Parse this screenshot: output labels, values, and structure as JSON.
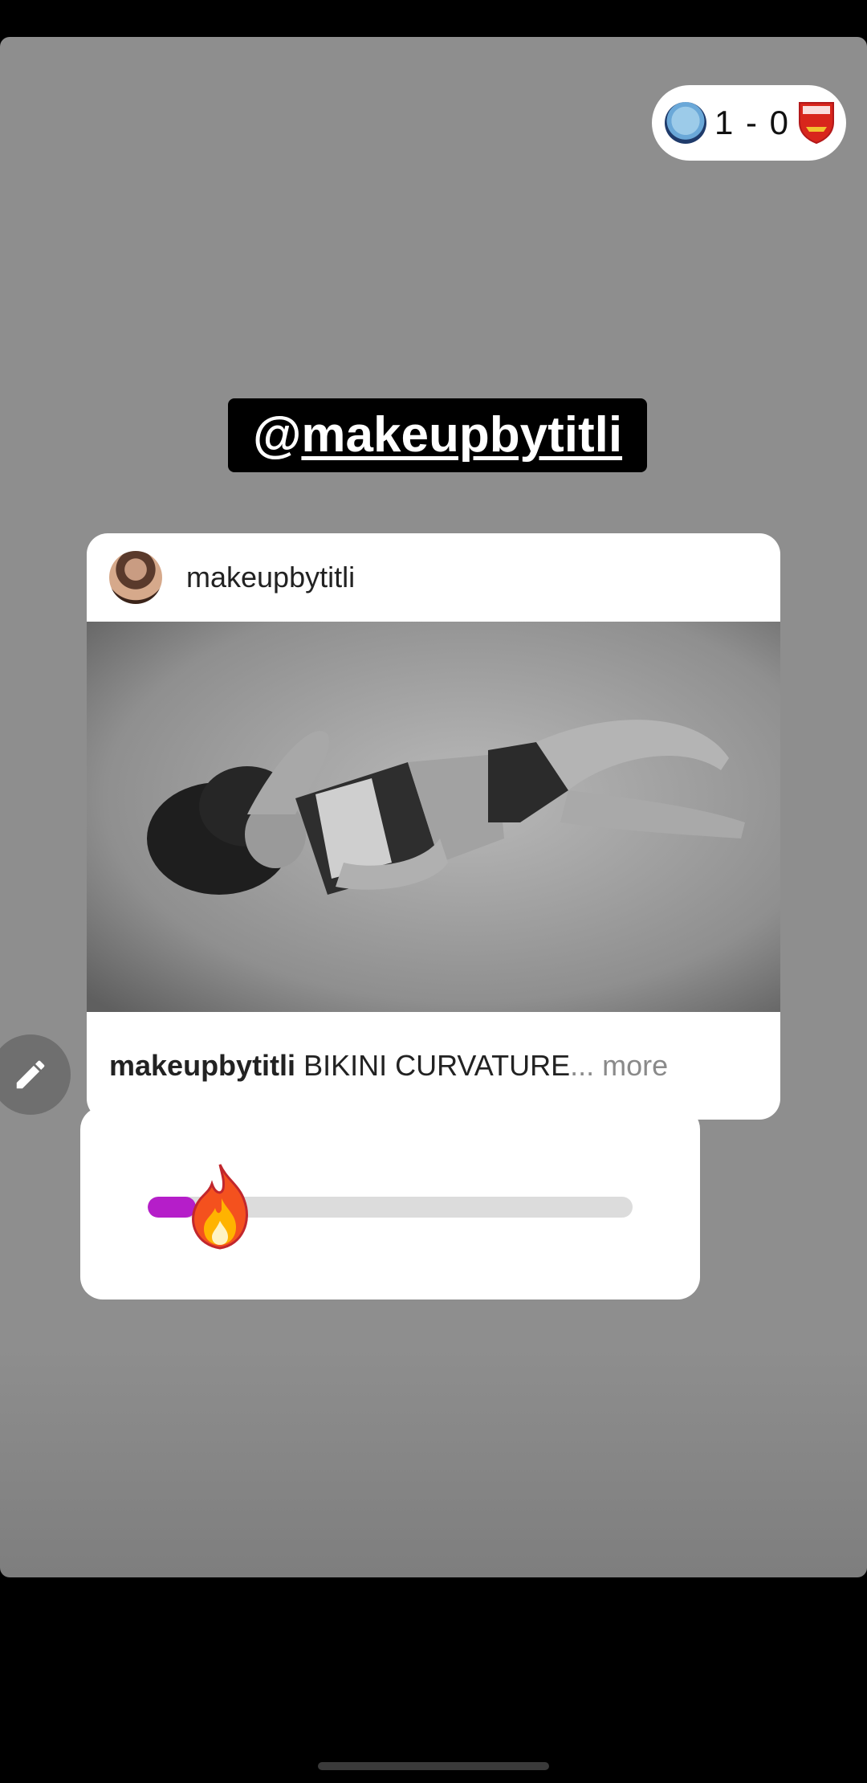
{
  "score": {
    "home_icon": "manchester-city-crest-icon",
    "away_icon": "arsenal-crest-icon",
    "text": "1 - 0"
  },
  "mention": {
    "at": "@",
    "handle": "makeupbytitli"
  },
  "post": {
    "username": "makeupbytitli",
    "caption_user": "makeupbytitli",
    "caption_text": "BIKINI CURVATURE",
    "caption_more": "... more"
  },
  "slider": {
    "emoji_icon": "fire-emoji-icon",
    "value": 0.1
  },
  "colors": {
    "story_bg": "#8e8e8e",
    "slider_fill": "#b51ec9",
    "slider_track": "#dcdcdc"
  }
}
